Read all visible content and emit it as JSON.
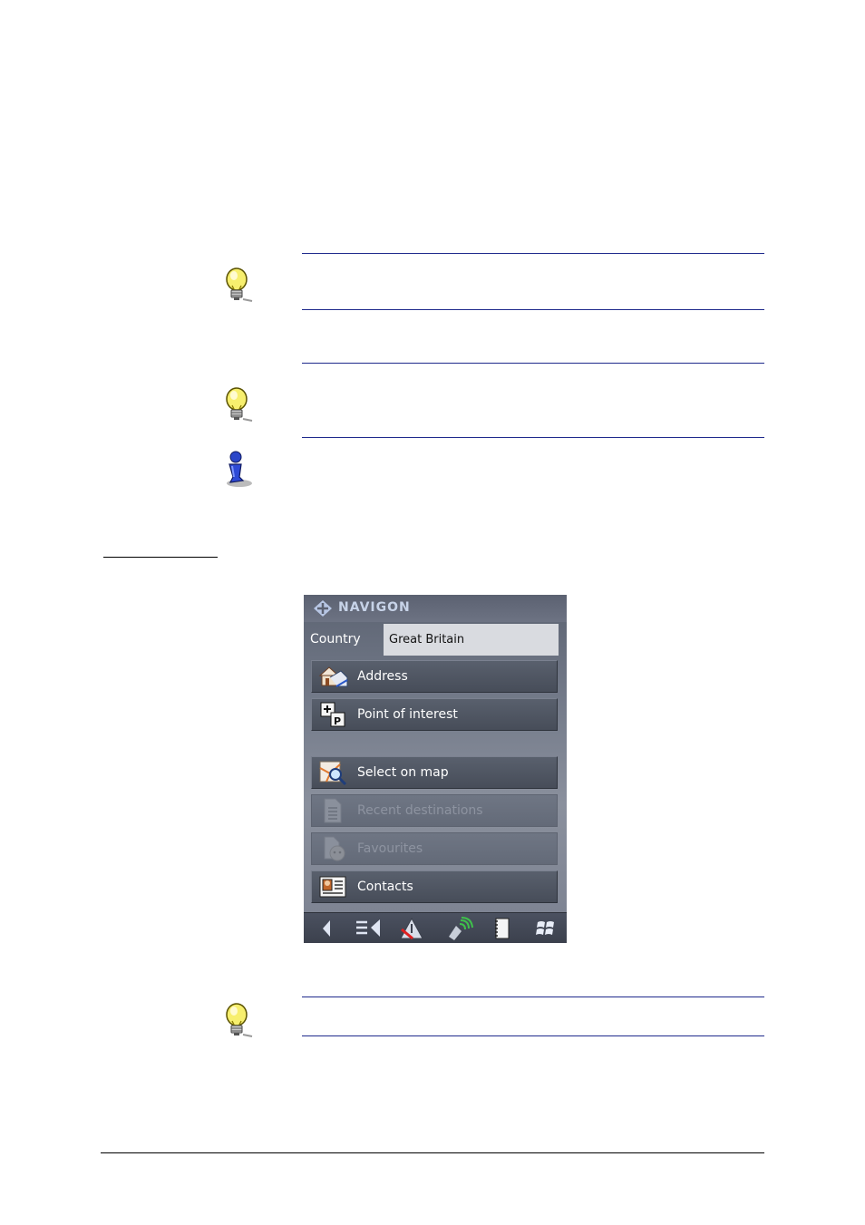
{
  "device": {
    "brand": "NAVIGON",
    "country": {
      "label": "Country",
      "value": "Great Britain"
    },
    "menu": [
      {
        "label": "Address",
        "icon": "house-icon",
        "enabled": true
      },
      {
        "label": "Point of interest",
        "icon": "poi-icon",
        "enabled": true
      },
      {
        "label": "Select on map",
        "icon": "map-search-icon",
        "enabled": true
      },
      {
        "label": "Recent destinations",
        "icon": "recent-list-icon",
        "enabled": false
      },
      {
        "label": "Favourites",
        "icon": "favourites-icon",
        "enabled": false
      },
      {
        "label": "Contacts",
        "icon": "contacts-card-icon",
        "enabled": true
      }
    ],
    "toolbar": [
      "back-arrow-icon",
      "menu-list-icon",
      "route-warning-icon",
      "gps-signal-icon",
      "notebook-icon",
      "windows-flag-icon"
    ]
  },
  "notes": [
    "lightbulb-tip-icon",
    "lightbulb-tip-icon",
    "info-person-icon",
    "lightbulb-tip-icon"
  ]
}
